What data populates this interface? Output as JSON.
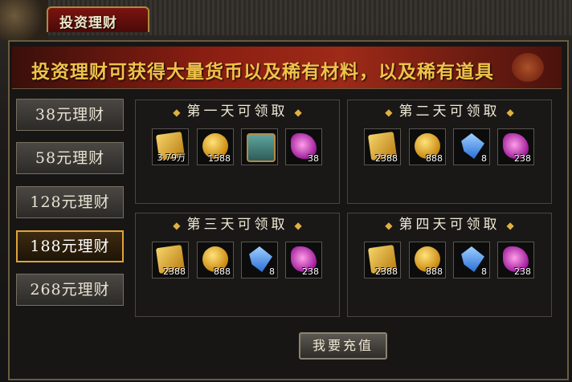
{
  "window": {
    "title": "投资理财"
  },
  "banner": {
    "text": "投资理财可获得大量货币以及稀有材料，以及稀有道具"
  },
  "tabs": [
    {
      "label": "38元理财",
      "active": false
    },
    {
      "label": "58元理财",
      "active": false
    },
    {
      "label": "128元理财",
      "active": false
    },
    {
      "label": "188元理财",
      "active": true
    },
    {
      "label": "268元理财",
      "active": false
    }
  ],
  "days": [
    {
      "title": "第一天可领取",
      "items": [
        {
          "icon": "gold-scroll-icon",
          "qty": "3.79万"
        },
        {
          "icon": "gold-coin-icon",
          "qty": "1588"
        },
        {
          "icon": "treasure-chest-icon",
          "qty": ""
        },
        {
          "icon": "pink-crystal-icon",
          "qty": "38"
        }
      ]
    },
    {
      "title": "第二天可领取",
      "items": [
        {
          "icon": "gold-scroll-icon",
          "qty": "2388"
        },
        {
          "icon": "gold-coin-icon",
          "qty": "888"
        },
        {
          "icon": "blue-gem-icon",
          "qty": "8"
        },
        {
          "icon": "pink-crystal-icon",
          "qty": "238"
        }
      ]
    },
    {
      "title": "第三天可领取",
      "items": [
        {
          "icon": "gold-scroll-icon",
          "qty": "2388"
        },
        {
          "icon": "gold-coin-icon",
          "qty": "888"
        },
        {
          "icon": "blue-gem-icon",
          "qty": "8"
        },
        {
          "icon": "pink-crystal-icon",
          "qty": "238"
        }
      ]
    },
    {
      "title": "第四天可领取",
      "items": [
        {
          "icon": "gold-scroll-icon",
          "qty": "2388"
        },
        {
          "icon": "gold-coin-icon",
          "qty": "888"
        },
        {
          "icon": "blue-gem-icon",
          "qty": "8"
        },
        {
          "icon": "pink-crystal-icon",
          "qty": "238"
        }
      ]
    }
  ],
  "recharge_label": "我要充值",
  "colors": {
    "banner_text": "#f0c24a",
    "active_tab_border": "#e0a438",
    "frame_red": "#7a1410"
  }
}
